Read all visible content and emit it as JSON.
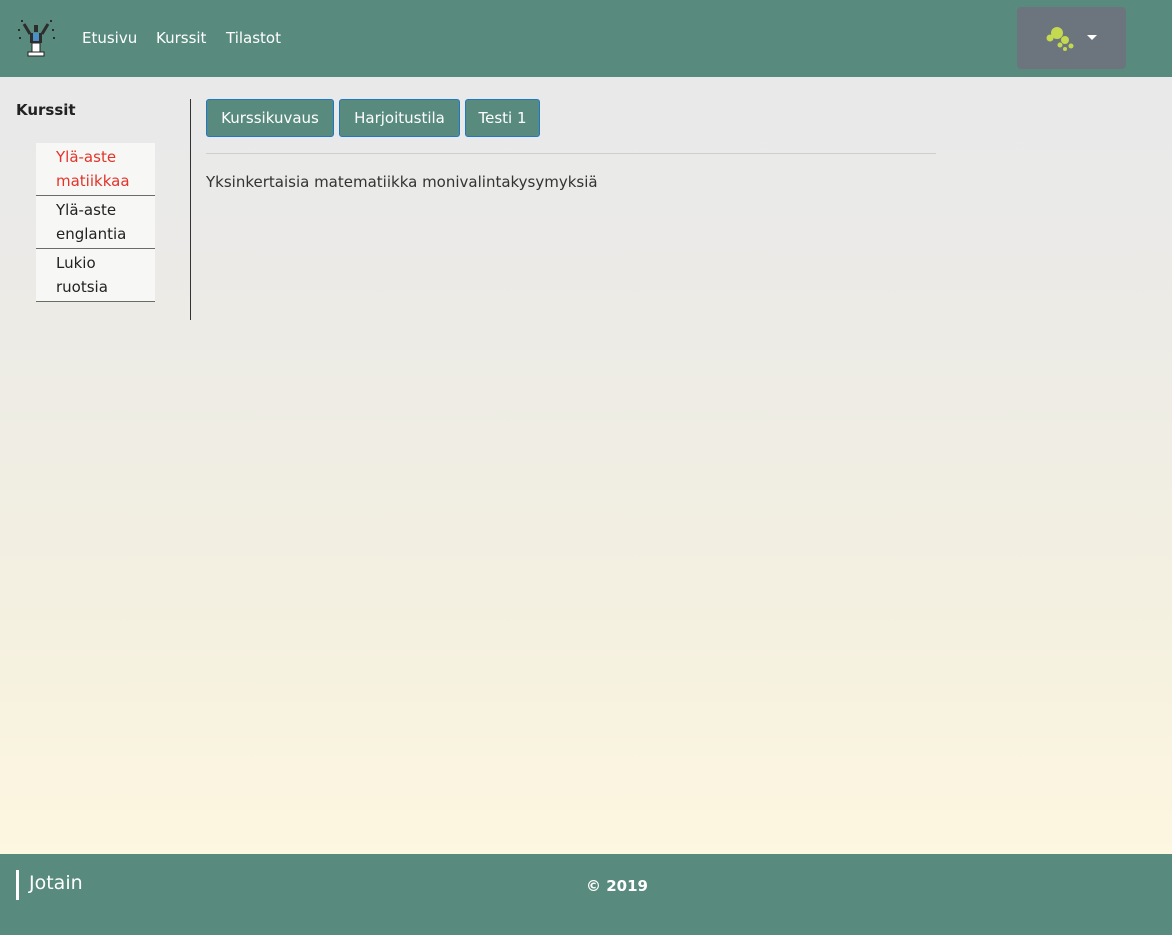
{
  "navbar": {
    "links": [
      "Etusivu",
      "Kurssit",
      "Tilastot"
    ],
    "user_menu_icon": "avatar-bubbles-icon",
    "colors": {
      "background": "#588b7e",
      "user_button": "#6c757d",
      "avatar": "#c3d94f"
    }
  },
  "sidebar": {
    "title": "Kurssit",
    "courses": [
      {
        "line1": "Ylä-aste",
        "line2": "matiikkaa",
        "active": true
      },
      {
        "line1": "Ylä-aste",
        "line2": "englantia",
        "active": false
      },
      {
        "line1": "Lukio",
        "line2": "ruotsia",
        "active": false
      }
    ],
    "colors": {
      "active": "#e2342b"
    }
  },
  "main": {
    "tabs": [
      "Kurssikuvaus",
      "Harjoitustila",
      "Testi 1"
    ],
    "description": "Yksinkertaisia matematiikka monivalintakysymyksiä"
  },
  "footer": {
    "brand": "Jotain",
    "copyright": "© 2019"
  }
}
